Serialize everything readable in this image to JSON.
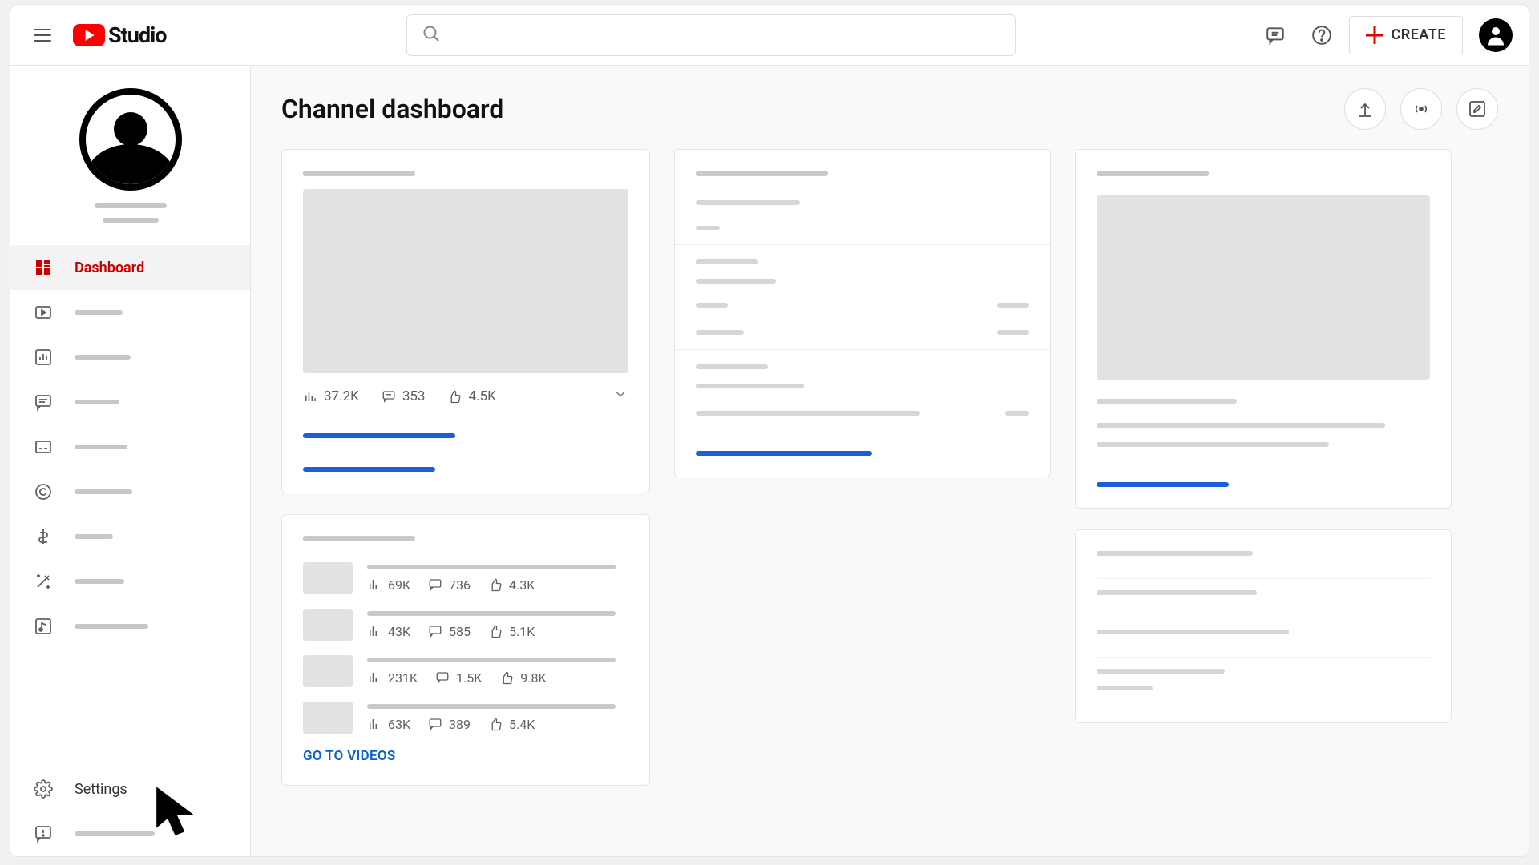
{
  "header": {
    "logo_text": "Studio",
    "search_placeholder": "",
    "create_label": "CREATE"
  },
  "sidebar": {
    "items": [
      {
        "label": "Dashboard"
      },
      {
        "label": ""
      },
      {
        "label": ""
      },
      {
        "label": ""
      },
      {
        "label": ""
      },
      {
        "label": ""
      },
      {
        "label": ""
      },
      {
        "label": ""
      },
      {
        "label": ""
      }
    ],
    "settings_label": "Settings"
  },
  "main": {
    "title": "Channel dashboard",
    "go_to_videos": "GO TO VIDEOS"
  },
  "card_latest": {
    "views": "37.2K",
    "comments": "353",
    "likes": "4.5K"
  },
  "video_list": [
    {
      "views": "69K",
      "comments": "736",
      "likes": "4.3K"
    },
    {
      "views": "43K",
      "comments": "585",
      "likes": "5.1K"
    },
    {
      "views": "231K",
      "comments": "1.5K",
      "likes": "9.8K"
    },
    {
      "views": "63K",
      "comments": "389",
      "likes": "5.4K"
    }
  ]
}
